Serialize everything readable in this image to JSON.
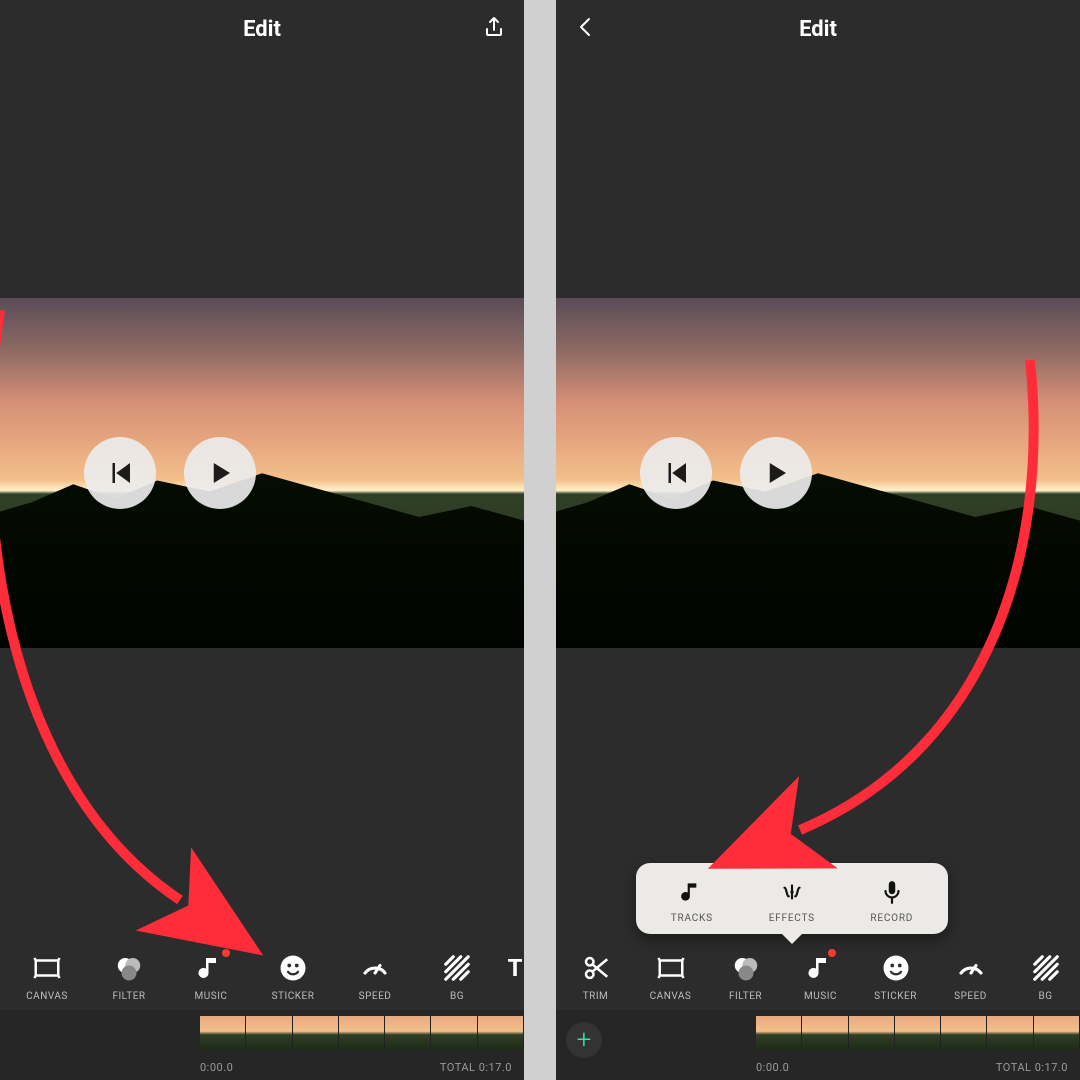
{
  "left": {
    "title": "Edit",
    "timeline": {
      "start": "0:00.0",
      "total": "TOTAL 0:17.0"
    },
    "tools": [
      {
        "id": "canvas",
        "label": "CANVAS"
      },
      {
        "id": "filter",
        "label": "FILTER"
      },
      {
        "id": "music",
        "label": "MUSIC",
        "dot": true
      },
      {
        "id": "sticker",
        "label": "STICKER"
      },
      {
        "id": "speed",
        "label": "SPEED"
      },
      {
        "id": "bg",
        "label": "BG"
      },
      {
        "id": "text",
        "label": "T"
      }
    ]
  },
  "right": {
    "title": "Edit",
    "timeline": {
      "start": "0:00.0",
      "total": "TOTAL 0:17.0"
    },
    "tools": [
      {
        "id": "trim",
        "label": "TRIM"
      },
      {
        "id": "canvas",
        "label": "CANVAS"
      },
      {
        "id": "filter",
        "label": "FILTER"
      },
      {
        "id": "music",
        "label": "MUSIC",
        "dot": true
      },
      {
        "id": "sticker",
        "label": "STICKER"
      },
      {
        "id": "speed",
        "label": "SPEED"
      },
      {
        "id": "bg",
        "label": "BG"
      }
    ],
    "popup": [
      {
        "id": "tracks",
        "label": "TRACKS"
      },
      {
        "id": "effects",
        "label": "EFFECTS"
      },
      {
        "id": "record",
        "label": "RECORD"
      }
    ]
  },
  "add_label": "+"
}
